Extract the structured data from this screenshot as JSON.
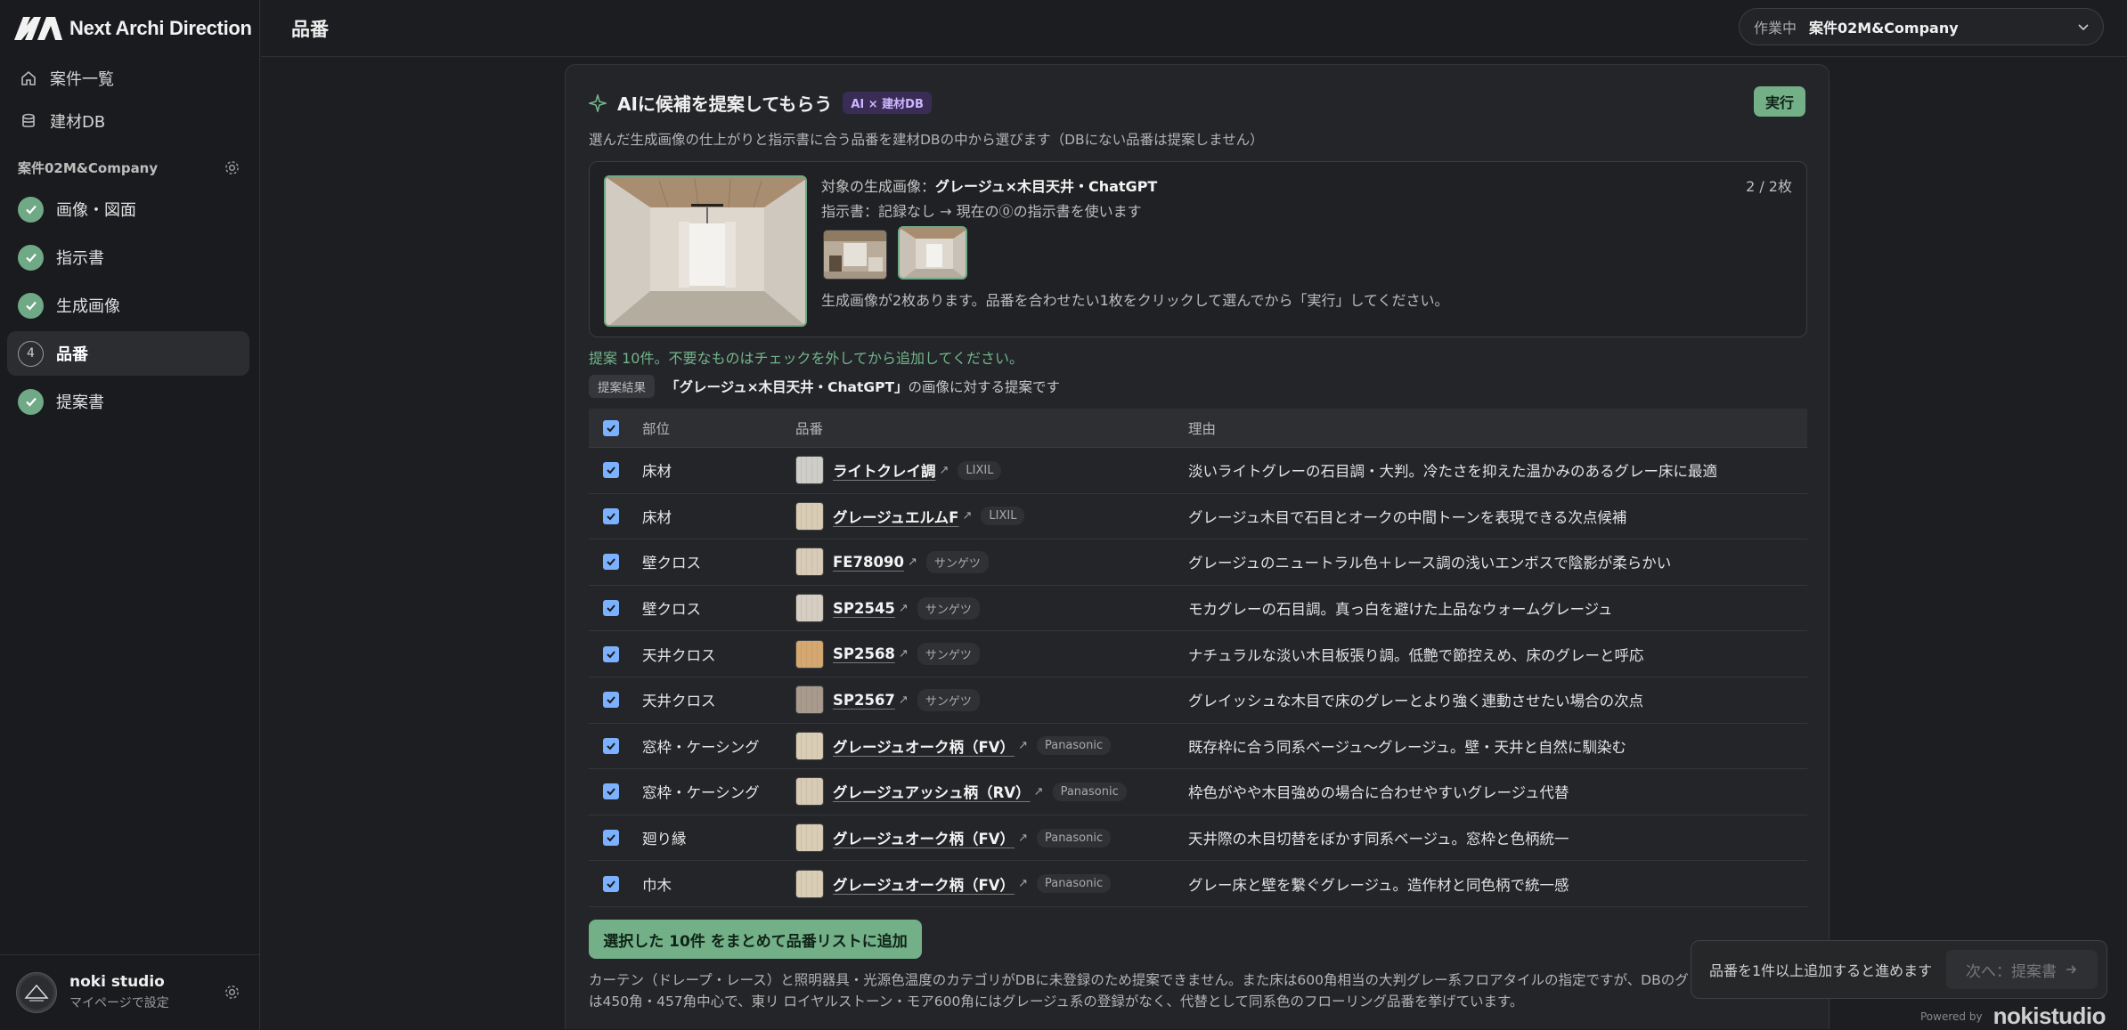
{
  "brand": {
    "name": "Next Archi Direction"
  },
  "sidebar": {
    "nav": [
      {
        "label": "案件一覧",
        "icon": "home-icon"
      },
      {
        "label": "建材DB",
        "icon": "database-icon"
      }
    ],
    "project_name": "案件02M&Company",
    "steps": [
      {
        "label": "画像・図面",
        "state": "done"
      },
      {
        "label": "指示書",
        "state": "done"
      },
      {
        "label": "生成画像",
        "state": "done"
      },
      {
        "label": "品番",
        "state": "current",
        "number": "4"
      },
      {
        "label": "提案書",
        "state": "done"
      }
    ],
    "user": {
      "name": "noki studio",
      "sub": "マイページで設定"
    }
  },
  "header": {
    "title": "品番",
    "project_select": {
      "label": "作業中",
      "value": "案件02M&Company"
    }
  },
  "ai": {
    "title": "AIに候補を提案してもらう",
    "badge": "AI × 建材DB",
    "run_label": "実行",
    "description": "選んだ生成画像の仕上がりと指示書に合う品番を建材DBの中から選びます（DBにない品番は提案しません）",
    "target": {
      "prefix": "対象の生成画像：",
      "name": "グレージュ×木目天井・ChatGPT",
      "count": "2 / 2枚",
      "instruction": "指示書：記録なし → 現在の⓪の指示書を使います",
      "hint": "生成画像が2枚あります。品番を合わせたい1枚をクリックして選んでから「実行」してください。"
    },
    "suggest_count": "提案 10件。不要なものはチェックを外してから追加してください。",
    "result_chip": "提案結果",
    "result_subject": "「グレージュ×木目天井・ChatGPT」",
    "result_suffix": "の画像に対する提案です"
  },
  "table": {
    "headers": {
      "part": "部位",
      "product": "品番",
      "reason": "理由"
    },
    "rows": [
      {
        "part": "床材",
        "product": "ライトクレイ調",
        "maker": "LIXIL",
        "reason": "淡いライトグレーの石目調・大判。冷たさを抑えた温かみのあるグレー床に最適",
        "swatch": "#cfcdc8"
      },
      {
        "part": "床材",
        "product": "グレージュエルムF",
        "maker": "LIXIL",
        "reason": "グレージュ木目で石目とオークの中間トーンを表現できる次点候補",
        "swatch": "#d9ccb4"
      },
      {
        "part": "壁クロス",
        "product": "FE78090",
        "maker": "サンゲツ",
        "reason": "グレージュのニュートラル色＋レース調の浅いエンボスで陰影が柔らかい",
        "swatch": "#d8ccb8"
      },
      {
        "part": "壁クロス",
        "product": "SP2545",
        "maker": "サンゲツ",
        "reason": "モカグレーの石目調。真っ白を避けた上品なウォームグレージュ",
        "swatch": "#d6cec2"
      },
      {
        "part": "天井クロス",
        "product": "SP2568",
        "maker": "サンゲツ",
        "reason": "ナチュラルな淡い木目板張り調。低艶で節控えめ、床のグレーと呼応",
        "swatch": "#d5a872"
      },
      {
        "part": "天井クロス",
        "product": "SP2567",
        "maker": "サンゲツ",
        "reason": "グレイッシュな木目で床のグレーとより強く連動させたい場合の次点",
        "swatch": "#a89a8c"
      },
      {
        "part": "窓枠・ケーシング",
        "product": "グレージュオーク柄（FV）",
        "maker": "Panasonic",
        "reason": "既存枠に合う同系ベージュ〜グレージュ。壁・天井と自然に馴染む",
        "swatch": "#d9cdb6"
      },
      {
        "part": "窓枠・ケーシング",
        "product": "グレージュアッシュ柄（RV）",
        "maker": "Panasonic",
        "reason": "枠色がやや木目強めの場合に合わせやすいグレージュ代替",
        "swatch": "#d7cbb5"
      },
      {
        "part": "廻り縁",
        "product": "グレージュオーク柄（FV）",
        "maker": "Panasonic",
        "reason": "天井際の木目切替をぼかす同系ベージュ。窓枠と色柄統一",
        "swatch": "#d9cdb6"
      },
      {
        "part": "巾木",
        "product": "グレージュオーク柄（FV）",
        "maker": "Panasonic",
        "reason": "グレー床と壁を繋ぐグレージュ。造作材と同色柄で統一感",
        "swatch": "#d9cdb6"
      }
    ]
  },
  "add_button": "選択した 10件 をまとめて品番リストに追加",
  "note": "カーテン（ドレープ・レース）と照明器具・光源色温度のカテゴリがDBに未登録のため提案できません。また床は600角相当の大判グレー系フロアタイルの指定ですが、DBのグレー石",
  "note2": "は450角・457角中心で、東リ ロイヤルストーン・モア600角にはグレージュ系の登録がなく、代替として同系色のフローリング品番を挙げています。",
  "next": {
    "message": "品番を1件以上追加すると進めます",
    "button": "次へ：提案書"
  },
  "powered": {
    "label": "Powered by",
    "brand": "nokistudio"
  },
  "colors": {
    "accent": "#73b088",
    "checkbox": "#7cb1ff",
    "badge": "#3a2d55"
  }
}
